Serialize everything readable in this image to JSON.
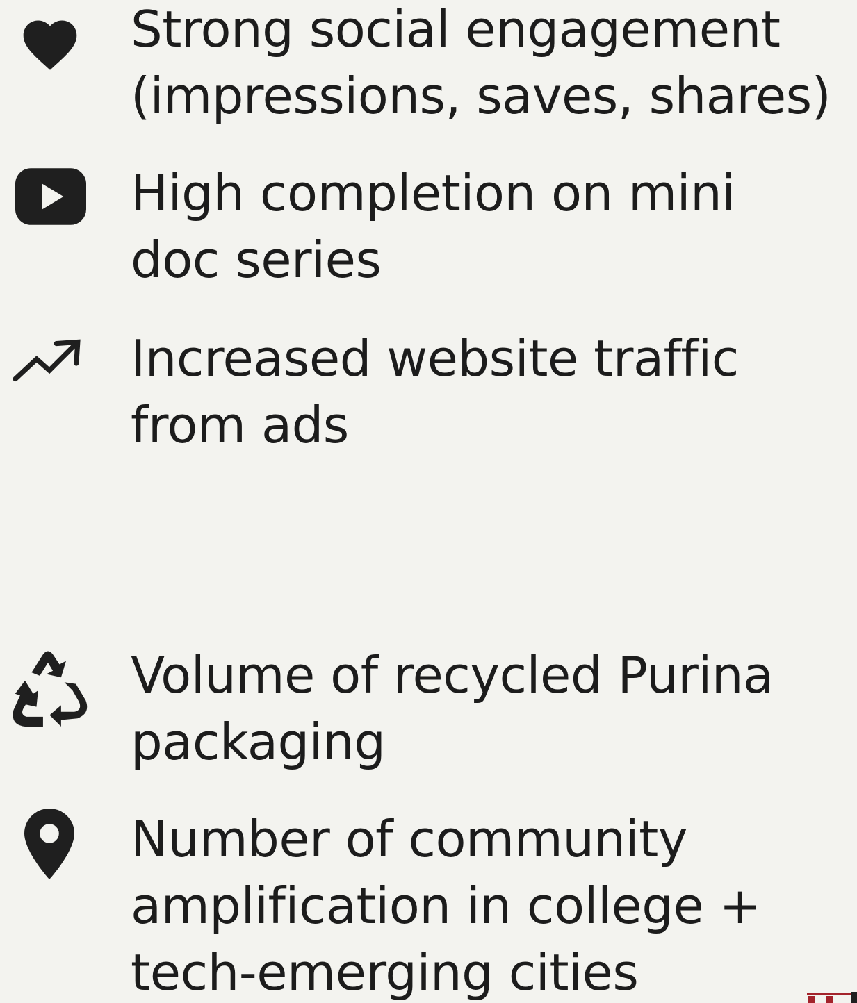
{
  "items": [
    {
      "icon": "heart-icon",
      "lines": [
        "Strong social engagement",
        "(impressions, saves, shares)"
      ]
    },
    {
      "icon": "play-button-icon",
      "lines": [
        "High completion on mini",
        "doc series"
      ]
    },
    {
      "icon": "trending-up-icon",
      "lines": [
        "Increased website traffic",
        "from ads"
      ]
    },
    {
      "icon": "recycle-icon",
      "lines": [
        "Volume of recycled Purina",
        "packaging"
      ]
    },
    {
      "icon": "location-pin-icon",
      "lines": [
        "Number of community",
        "amplification in college +",
        "tech-emerging cities"
      ]
    }
  ],
  "colors": {
    "background": "#f3f3ef",
    "text": "#1c1c1c",
    "icon": "#1f1f1f",
    "corner_mark": "#a3232b"
  }
}
